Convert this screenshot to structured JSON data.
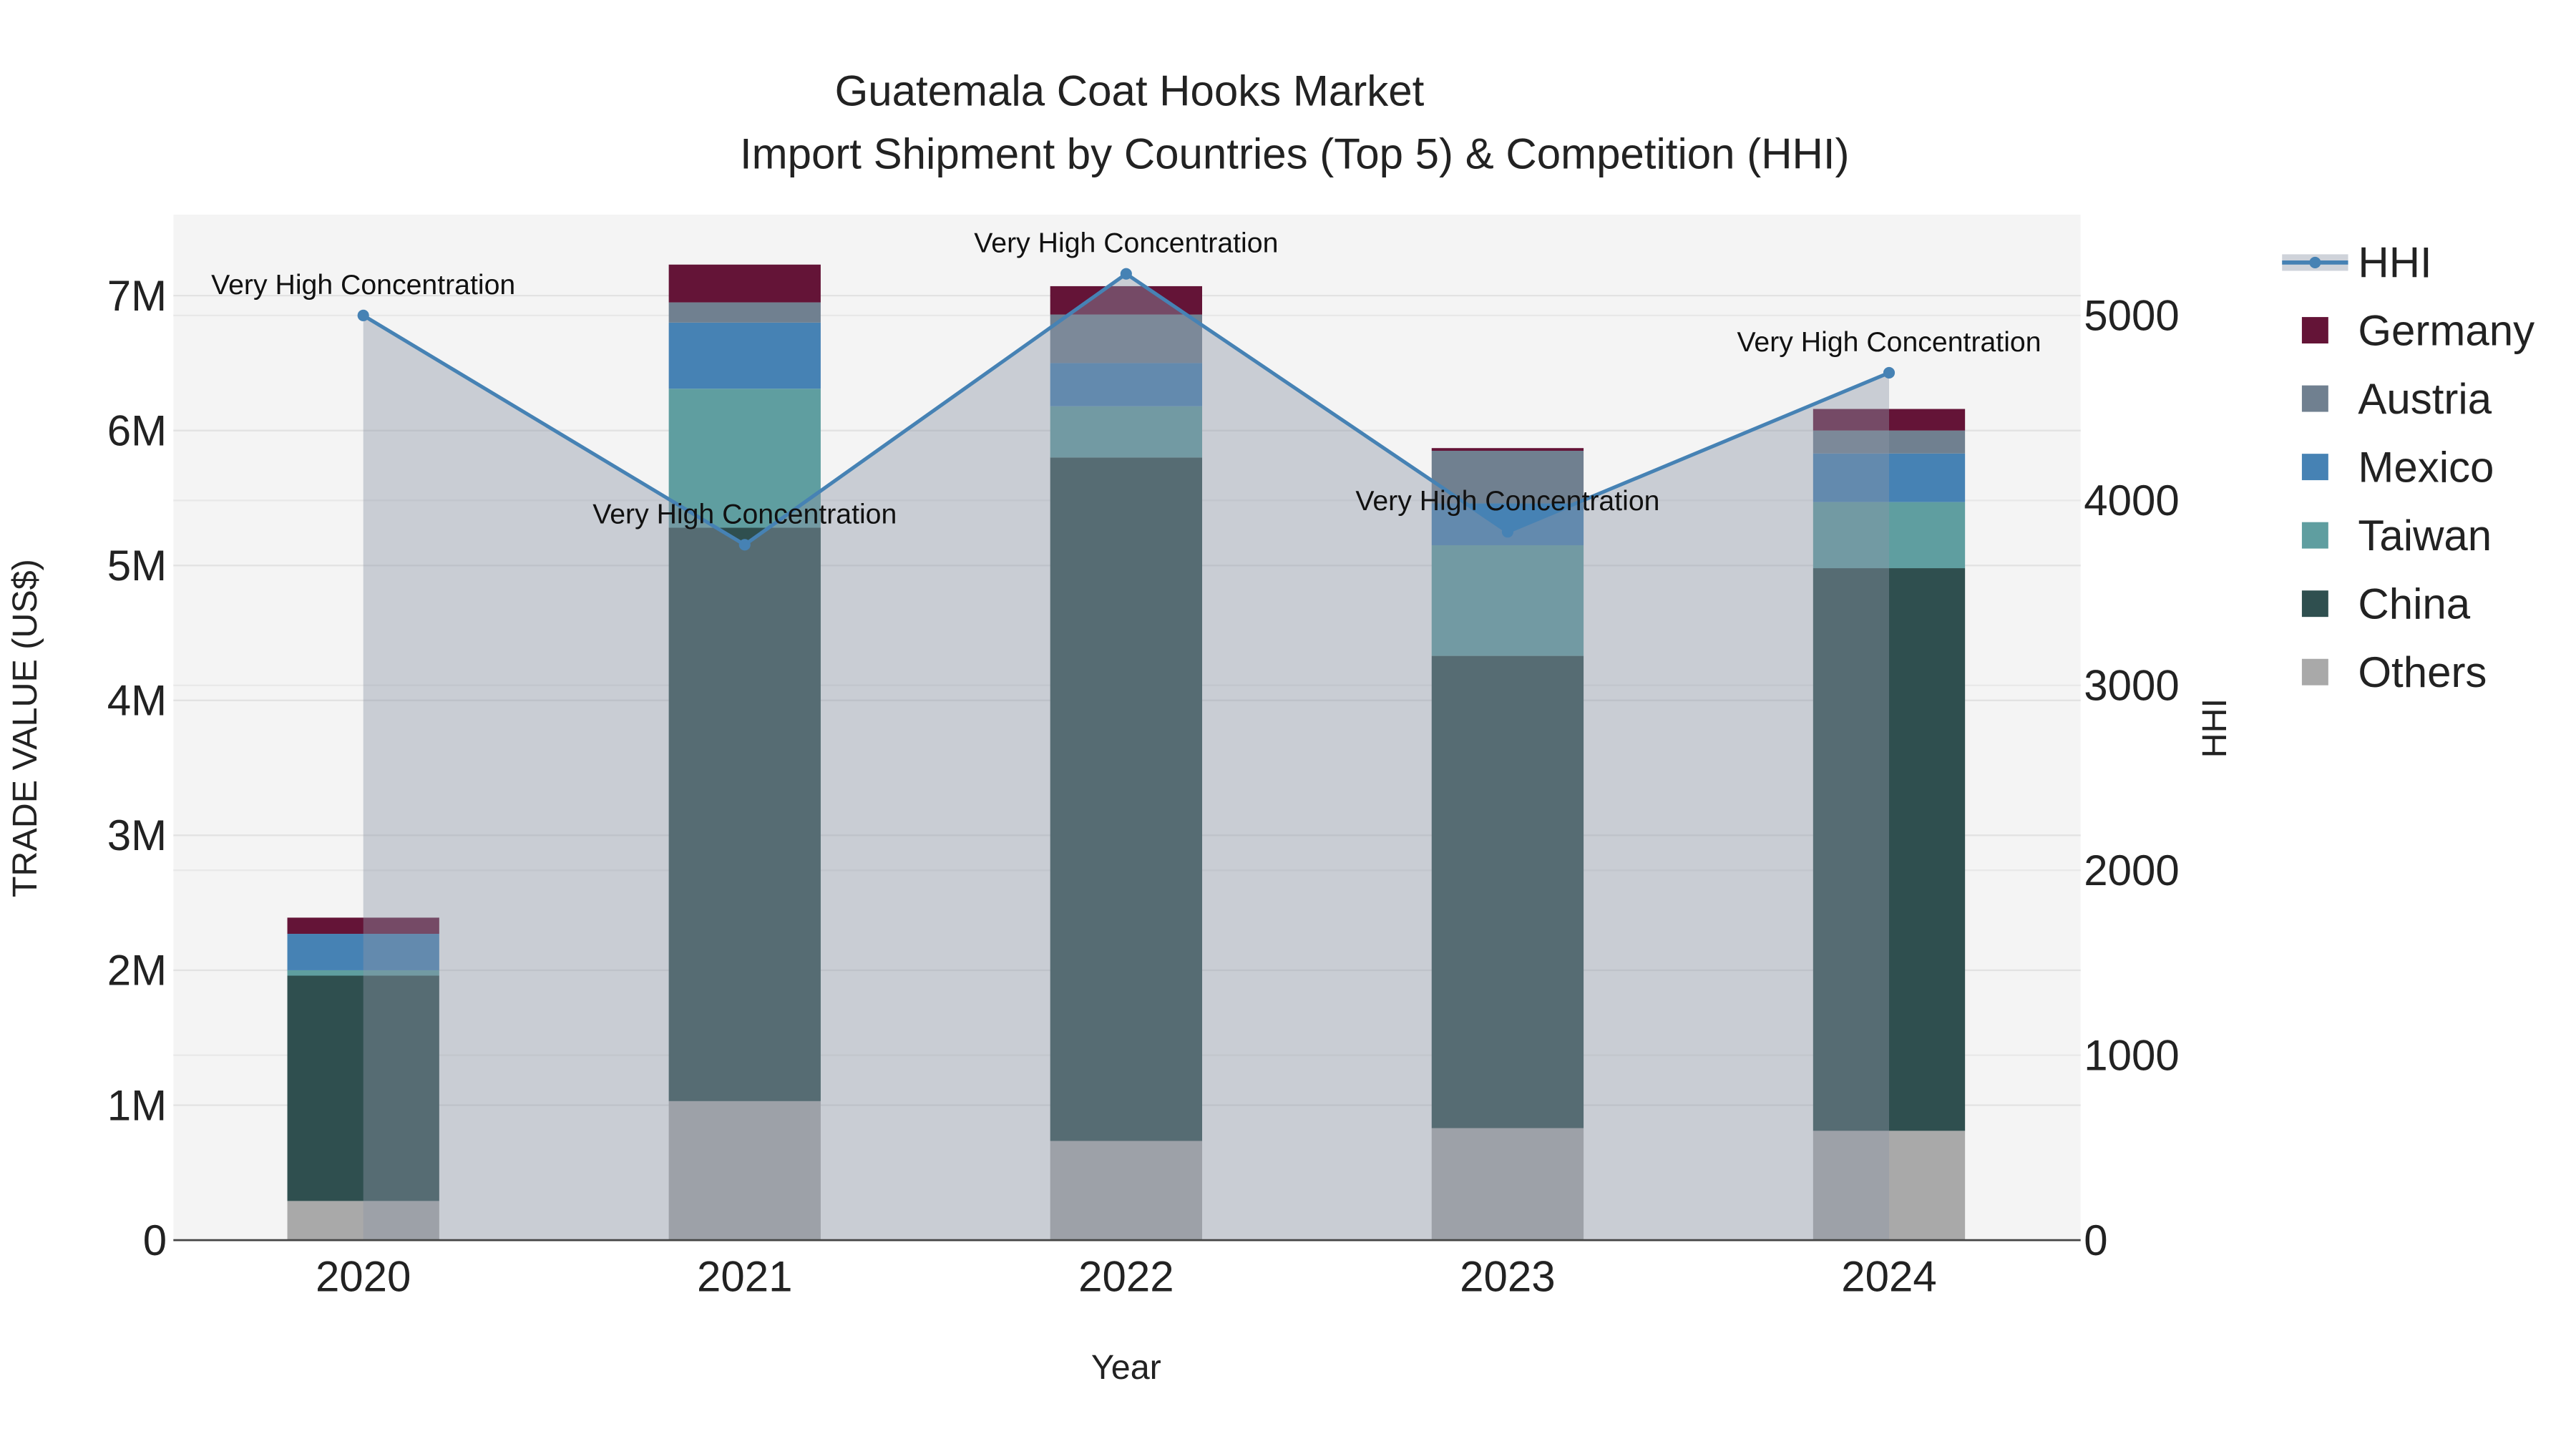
{
  "chart_data": {
    "type": "bar",
    "stacked": true,
    "title": "Guatemala Coat Hooks Market",
    "subtitle": "Import Shipment by Countries (Top 5) & Competition (HHI)",
    "xlabel": "Year",
    "ylabel": "TRADE VALUE (US$)",
    "y2label": "HHI",
    "categories": [
      "2020",
      "2021",
      "2022",
      "2023",
      "2024"
    ],
    "ylim": [
      0,
      7600000
    ],
    "y2lim": [
      0,
      5545
    ],
    "yticks": [
      0,
      1000000,
      2000000,
      3000000,
      4000000,
      5000000,
      6000000,
      7000000
    ],
    "ytick_labels": [
      "0",
      "1M",
      "2M",
      "3M",
      "4M",
      "5M",
      "6M",
      "7M"
    ],
    "y2ticks": [
      0,
      1000,
      2000,
      3000,
      4000,
      5000
    ],
    "y2tick_labels": [
      "0",
      "1000",
      "2000",
      "3000",
      "4000",
      "5000"
    ],
    "series": [
      {
        "name": "Others",
        "color": "#a9a9a9",
        "values": [
          290000,
          1030000,
          735000,
          830000,
          810000
        ]
      },
      {
        "name": "China",
        "color": "#2f4f4f",
        "values": [
          1670000,
          4250000,
          5065000,
          3500000,
          4170000
        ]
      },
      {
        "name": "Taiwan",
        "color": "#5f9ea0",
        "values": [
          40000,
          1030000,
          380000,
          820000,
          490000
        ]
      },
      {
        "name": "Mexico",
        "color": "#4682b4",
        "values": [
          270000,
          490000,
          320000,
          310000,
          360000
        ]
      },
      {
        "name": "Austria",
        "color": "#708090",
        "values": [
          0,
          150000,
          360000,
          390000,
          170000
        ]
      },
      {
        "name": "Germany",
        "color": "#641437",
        "values": [
          120000,
          280000,
          210000,
          20000,
          160000
        ]
      }
    ],
    "hhi": {
      "name": "HHI",
      "color": "#4682b4",
      "values": [
        5000,
        3760,
        5225,
        3830,
        4690
      ],
      "annotations": [
        "Very High Concentration",
        "Very High Concentration",
        "Very High Concentration",
        "Very High Concentration",
        "Very High Concentration"
      ]
    },
    "legend": [
      "HHI",
      "Germany",
      "Austria",
      "Mexico",
      "Taiwan",
      "China",
      "Others"
    ],
    "legend_position": "right",
    "grid": true
  }
}
